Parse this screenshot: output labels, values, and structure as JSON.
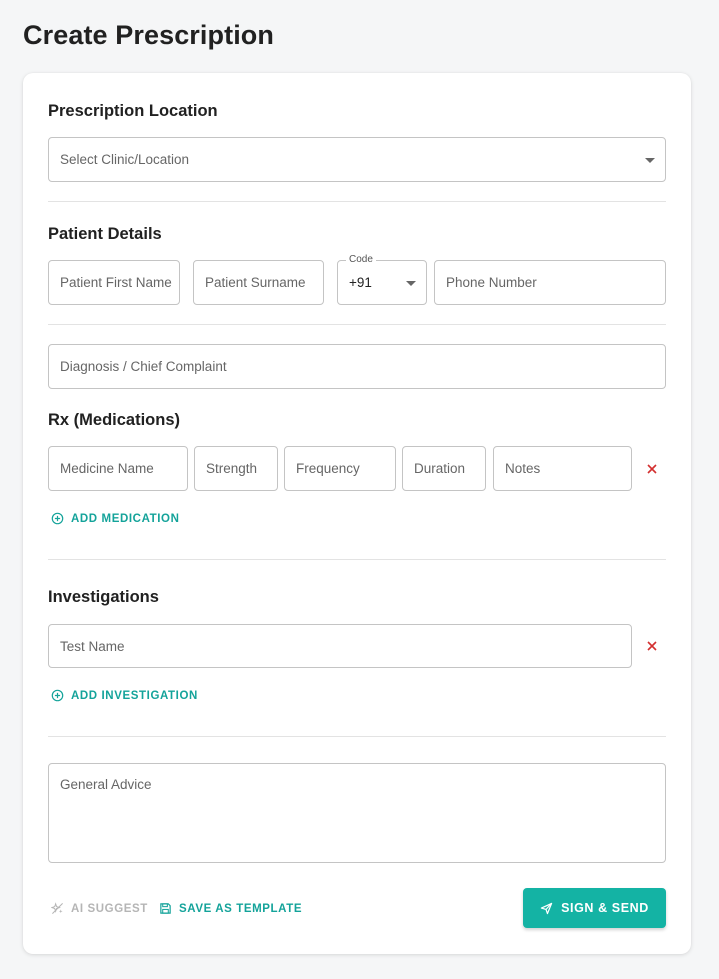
{
  "page": {
    "title": "Create Prescription"
  },
  "location": {
    "title": "Prescription Location",
    "select_placeholder": "Select Clinic/Location"
  },
  "patient": {
    "title": "Patient Details",
    "first_name_placeholder": "Patient First Name",
    "surname_placeholder": "Patient Surname",
    "code_label": "Code",
    "code_value": "+91",
    "phone_placeholder": "Phone Number"
  },
  "diagnosis": {
    "placeholder": "Diagnosis / Chief Complaint"
  },
  "rx": {
    "title": "Rx (Medications)",
    "medicine_placeholder": "Medicine Name",
    "strength_placeholder": "Strength",
    "frequency_placeholder": "Frequency",
    "duration_placeholder": "Duration",
    "notes_placeholder": "Notes",
    "add_label": "ADD MEDICATION"
  },
  "investigations": {
    "title": "Investigations",
    "test_placeholder": "Test Name",
    "add_label": "ADD INVESTIGATION"
  },
  "advice": {
    "placeholder": "General Advice"
  },
  "actions": {
    "ai_suggest_label": "AI SUGGEST",
    "save_template_label": "SAVE AS TEMPLATE",
    "sign_send_label": "SIGN & SEND"
  },
  "colors": {
    "accent": "#14a39a",
    "primary_button": "#14b3a4",
    "remove": "#d32f2f",
    "disabled": "#b5b5b5"
  },
  "icons": {
    "remove": "close-icon",
    "add": "plus-circle-icon",
    "ai": "sparkle-icon",
    "save": "save-icon",
    "send": "send-icon",
    "dropdown": "caret-down-icon"
  }
}
